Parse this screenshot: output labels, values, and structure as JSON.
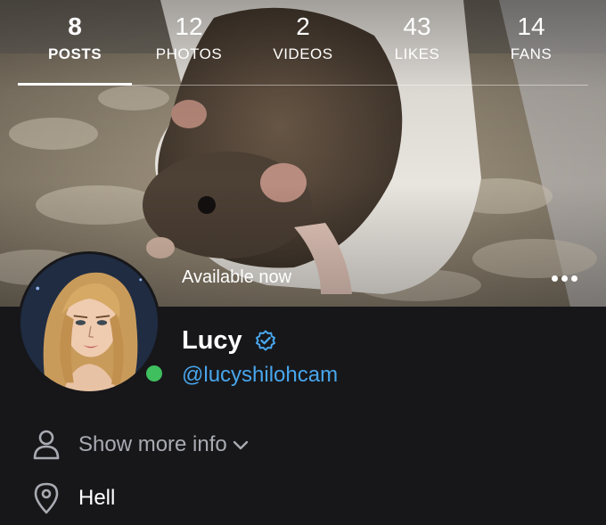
{
  "stats": {
    "items": [
      {
        "value": "8",
        "label": "POSTS"
      },
      {
        "value": "12",
        "label": "PHOTOS"
      },
      {
        "value": "2",
        "label": "VIDEOS"
      },
      {
        "value": "43",
        "label": "LIKES"
      },
      {
        "value": "14",
        "label": "FANS"
      }
    ]
  },
  "cover": {
    "status_text": "Available now"
  },
  "profile": {
    "name": "Lucy",
    "handle": "@lucyshilohcam",
    "online": true
  },
  "info": {
    "more_label": "Show more info",
    "location": "Hell"
  },
  "colors": {
    "background": "#17171a",
    "accent_link": "#48a6ec",
    "online": "#3fbf5e",
    "muted_text": "#a9abb2"
  },
  "icons": {
    "verified": "verified-badge-icon",
    "more": "more-horizontal-icon",
    "user": "user-icon",
    "location": "location-pin-icon",
    "chevron": "chevron-down-icon"
  }
}
